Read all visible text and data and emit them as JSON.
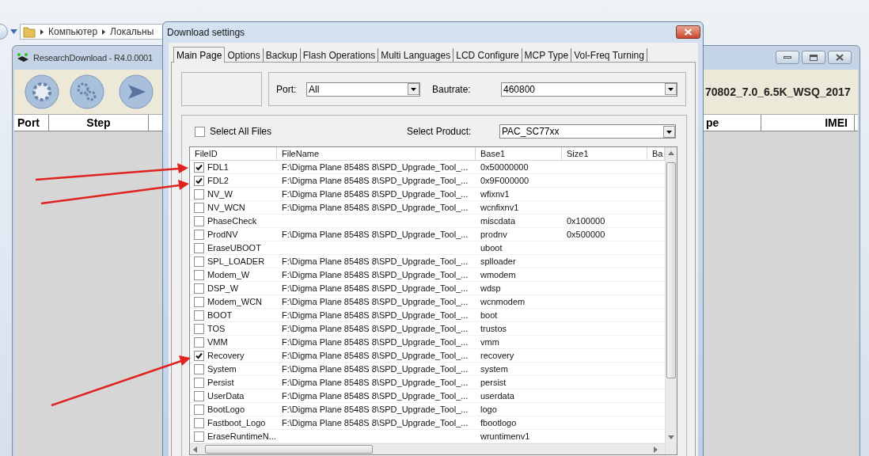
{
  "explorer": {
    "breadcrumbs": [
      "Компьютер",
      "Локальны"
    ]
  },
  "main_window": {
    "title": "ResearchDownload - R4.0.0001",
    "toolbar_text": "70802_7.0_6.5K_WSQ_2017",
    "columns": [
      "Port",
      "Step",
      "pe",
      "IMEI"
    ]
  },
  "dialog": {
    "title": "Download settings",
    "tabs": [
      {
        "label": "Main Page",
        "selected": true
      },
      {
        "label": "Options",
        "selected": false
      },
      {
        "label": "Backup",
        "selected": false
      },
      {
        "label": "Flash Operations",
        "selected": false
      },
      {
        "label": "Multi Languages",
        "selected": false
      },
      {
        "label": "LCD Configure",
        "selected": false
      },
      {
        "label": "MCP Type",
        "selected": false
      },
      {
        "label": "Vol-Freq Turning",
        "selected": false
      }
    ],
    "port": {
      "label": "Port:",
      "value": "All"
    },
    "baudrate": {
      "label": "Bautrate:",
      "value": "460800"
    },
    "select_all": {
      "label": "Select All Files",
      "checked": false
    },
    "product": {
      "label": "Select Product:",
      "value": "PAC_SC77xx"
    },
    "table": {
      "columns": [
        "FileID",
        "FileName",
        "Base1",
        "Size1",
        "Ba"
      ],
      "rows": [
        {
          "checked": true,
          "file_id": "FDL1",
          "file_name": "F:\\Digma Plane 8548S 8\\SPD_Upgrade_Tool_...",
          "base1": "0x50000000"
        },
        {
          "checked": true,
          "file_id": "FDL2",
          "file_name": "F:\\Digma Plane 8548S 8\\SPD_Upgrade_Tool_...",
          "base1": "0x9F000000"
        },
        {
          "checked": false,
          "file_id": "NV_W",
          "file_name": "F:\\Digma Plane 8548S 8\\SPD_Upgrade_Tool_...",
          "base1": "wfixnv1"
        },
        {
          "checked": false,
          "file_id": "NV_WCN",
          "file_name": "F:\\Digma Plane 8548S 8\\SPD_Upgrade_Tool_...",
          "base1": "wcnfixnv1"
        },
        {
          "checked": false,
          "file_id": "PhaseCheck",
          "base1": "miscdata",
          "size1": "0x100000"
        },
        {
          "checked": false,
          "file_id": "ProdNV",
          "file_name": "F:\\Digma Plane 8548S 8\\SPD_Upgrade_Tool_...",
          "base1": "prodnv",
          "size1": "0x500000"
        },
        {
          "checked": false,
          "file_id": "EraseUBOOT",
          "base1": "uboot"
        },
        {
          "checked": false,
          "file_id": "SPL_LOADER",
          "file_name": "F:\\Digma Plane 8548S 8\\SPD_Upgrade_Tool_...",
          "base1": "splloader"
        },
        {
          "checked": false,
          "file_id": "Modem_W",
          "file_name": "F:\\Digma Plane 8548S 8\\SPD_Upgrade_Tool_...",
          "base1": "wmodem"
        },
        {
          "checked": false,
          "file_id": "DSP_W",
          "file_name": "F:\\Digma Plane 8548S 8\\SPD_Upgrade_Tool_...",
          "base1": "wdsp"
        },
        {
          "checked": false,
          "file_id": "Modem_WCN",
          "file_name": "F:\\Digma Plane 8548S 8\\SPD_Upgrade_Tool_...",
          "base1": "wcnmodem"
        },
        {
          "checked": false,
          "file_id": "BOOT",
          "file_name": "F:\\Digma Plane 8548S 8\\SPD_Upgrade_Tool_...",
          "base1": "boot"
        },
        {
          "checked": false,
          "file_id": "TOS",
          "file_name": "F:\\Digma Plane 8548S 8\\SPD_Upgrade_Tool_...",
          "base1": "trustos"
        },
        {
          "checked": false,
          "file_id": "VMM",
          "file_name": "F:\\Digma Plane 8548S 8\\SPD_Upgrade_Tool_...",
          "base1": "vmm"
        },
        {
          "checked": true,
          "file_id": "Recovery",
          "file_name": "F:\\Digma Plane 8548S 8\\SPD_Upgrade_Tool_...",
          "base1": "recovery"
        },
        {
          "checked": false,
          "file_id": "System",
          "file_name": "F:\\Digma Plane 8548S 8\\SPD_Upgrade_Tool_...",
          "base1": "system"
        },
        {
          "checked": false,
          "file_id": "Persist",
          "file_name": "F:\\Digma Plane 8548S 8\\SPD_Upgrade_Tool_...",
          "base1": "persist"
        },
        {
          "checked": false,
          "file_id": "UserData",
          "file_name": "F:\\Digma Plane 8548S 8\\SPD_Upgrade_Tool_...",
          "base1": "userdata"
        },
        {
          "checked": false,
          "file_id": "BootLogo",
          "file_name": "F:\\Digma Plane 8548S 8\\SPD_Upgrade_Tool_...",
          "base1": "logo"
        },
        {
          "checked": false,
          "file_id": "Fastboot_Logo",
          "file_name": "F:\\Digma Plane 8548S 8\\SPD_Upgrade_Tool_...",
          "base1": "fbootlogo"
        },
        {
          "checked": false,
          "file_id": "EraseRuntimeN...",
          "base1": "wruntimenv1"
        }
      ]
    }
  }
}
